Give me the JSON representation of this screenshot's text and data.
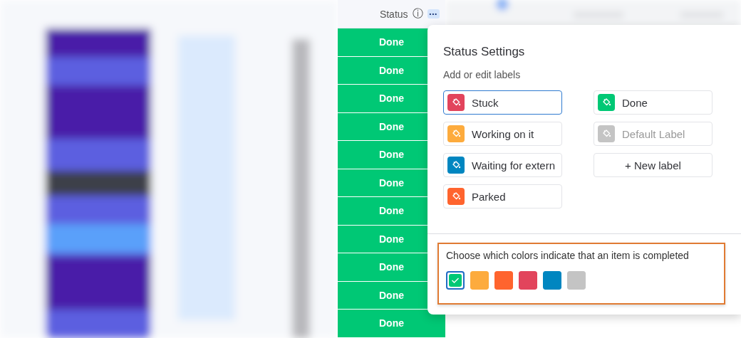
{
  "status_column": {
    "header": "Status",
    "info_icon": "ⓘ",
    "menu_glyph": "•••",
    "rows": [
      {
        "label": "Done",
        "color": "#00c875"
      },
      {
        "label": "Done",
        "color": "#00c875"
      },
      {
        "label": "Done",
        "color": "#00c875"
      },
      {
        "label": "Done",
        "color": "#00c875"
      },
      {
        "label": "Done",
        "color": "#00c875"
      },
      {
        "label": "Done",
        "color": "#00c875"
      },
      {
        "label": "Done",
        "color": "#00c875"
      },
      {
        "label": "Done",
        "color": "#00c875"
      },
      {
        "label": "Done",
        "color": "#00c875"
      },
      {
        "label": "Done",
        "color": "#00c875"
      },
      {
        "label": "Done",
        "color": "#00c875"
      }
    ]
  },
  "status_settings": {
    "title": "Status Settings",
    "subtitle": "Add or edit labels",
    "labels": [
      {
        "kind": "label",
        "text": "Stuck",
        "color": "#e2445c",
        "selected": true
      },
      {
        "kind": "label",
        "text": "Done",
        "color": "#00c875",
        "selected": false
      },
      {
        "kind": "label",
        "text": "Working on it",
        "color": "#fdab3d",
        "selected": false
      },
      {
        "kind": "placeholder",
        "text": "Default Label",
        "color": "#c4c4c4",
        "selected": false
      },
      {
        "kind": "label",
        "text": "Waiting for extern",
        "color": "#0086c0",
        "selected": false
      },
      {
        "kind": "new",
        "text": "+ New label",
        "selected": false
      },
      {
        "kind": "label",
        "text": "Parked",
        "color": "#ff642e",
        "selected": false
      }
    ],
    "completed": {
      "prompt": "Choose which colors indicate that an item is completed",
      "swatches": [
        {
          "color": "#00c875",
          "selected": true
        },
        {
          "color": "#fdab3d",
          "selected": false
        },
        {
          "color": "#ff642e",
          "selected": false
        },
        {
          "color": "#e2445c",
          "selected": false
        },
        {
          "color": "#0086c0",
          "selected": false
        },
        {
          "color": "#c4c4c4",
          "selected": false
        }
      ]
    }
  }
}
